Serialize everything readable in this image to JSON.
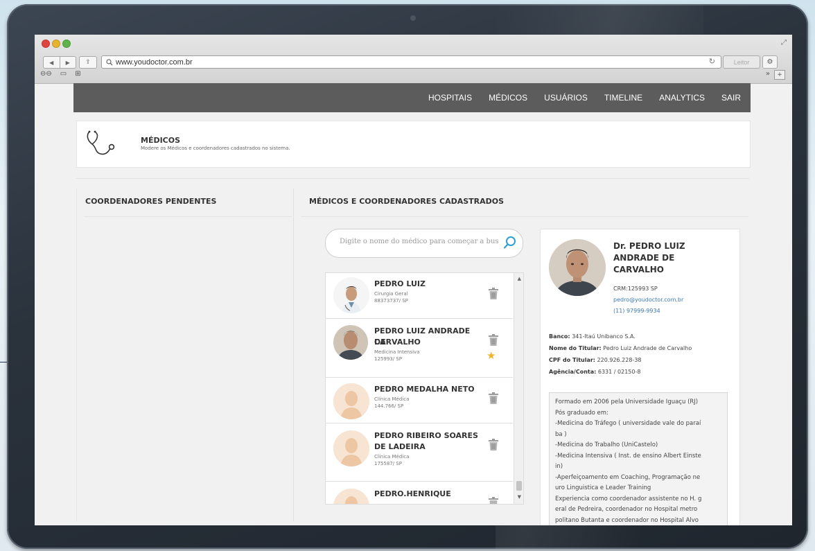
{
  "browser": {
    "url": "www.youdoctor.com.br",
    "reader_label": "Leitor"
  },
  "nav": {
    "items": [
      "HOSPITAIS",
      "MÉDICOS",
      "USUÁRIOS",
      "TIMELINE",
      "ANALYTICS",
      "SAIR"
    ]
  },
  "header": {
    "title": "MÉDICOS",
    "subtitle": "Modere os Médicos e coordenadores cadastrados no sistema."
  },
  "left": {
    "title": "COORDENADORES PENDENTES"
  },
  "right": {
    "title": "MÉDICOS E COORDENADORES CADASTRADOS",
    "search_placeholder": "Digite o nome do médico para começar a bus"
  },
  "doctors": [
    {
      "name_lines": [
        "PEDRO LUIZ"
      ],
      "specialty": "Cirurgia Geral",
      "crm": "88373737/ SP",
      "starred": false
    },
    {
      "name_lines": [
        "PEDRO LUIZ ANDRADE DE",
        "CARVALHO"
      ],
      "specialty": "Medicina Intensiva",
      "crm": "125993/ SP",
      "starred": true
    },
    {
      "name_lines": [
        "PEDRO MEDALHA NETO"
      ],
      "specialty": "Clínica Médica",
      "crm": "144.766/ SP",
      "starred": false
    },
    {
      "name_lines": [
        "PEDRO RIBEIRO SOARES",
        "DE LADEIRA"
      ],
      "specialty": "Clínica Médica",
      "crm": "175587/ SP",
      "starred": false
    },
    {
      "name_lines": [
        "PEDRO.HENRIQUE"
      ],
      "specialty": "",
      "crm": "",
      "starred": false
    }
  ],
  "detail": {
    "name_lines": [
      "Dr. PEDRO LUIZ",
      "ANDRADE DE",
      "CARVALHO"
    ],
    "crm": "CRM:125993 SP",
    "email": "pedro@youdoctor.com.br",
    "phone": "(11) 97999-9934",
    "bank": [
      {
        "label": "Banco:",
        "value": "341-Itaú Unibanco S.A."
      },
      {
        "label": "Nome do Titular:",
        "value": "Pedro Luiz Andrade de Carvalho"
      },
      {
        "label": "CPF do Titular:",
        "value": "220.926.228-38"
      },
      {
        "label": "Agência/Conta:",
        "value": "6331 / 02150-8"
      }
    ],
    "bio_lines": [
      "Formado em 2006 pela Universidade Iguaçu (RJ)",
      "Pós graduado em:",
      "-Medicina do Tráfego ( universidade vale do paraí",
      "ba )",
      "-Medicina do Trabalho (UniCastelo)",
      "-Medicina Intensiva ( Inst. de ensino Albert Einste",
      "in)",
      "-Aperfeiçoamento em Coaching, Programação ne",
      "uro Linguistica e Leader Training",
      "Experiencia como coordenador assistente no H. g",
      "eral de Pedreira, coordenador no Hospital metro",
      "politano Butanta e coordenador no Hospital Alvo"
    ]
  }
}
